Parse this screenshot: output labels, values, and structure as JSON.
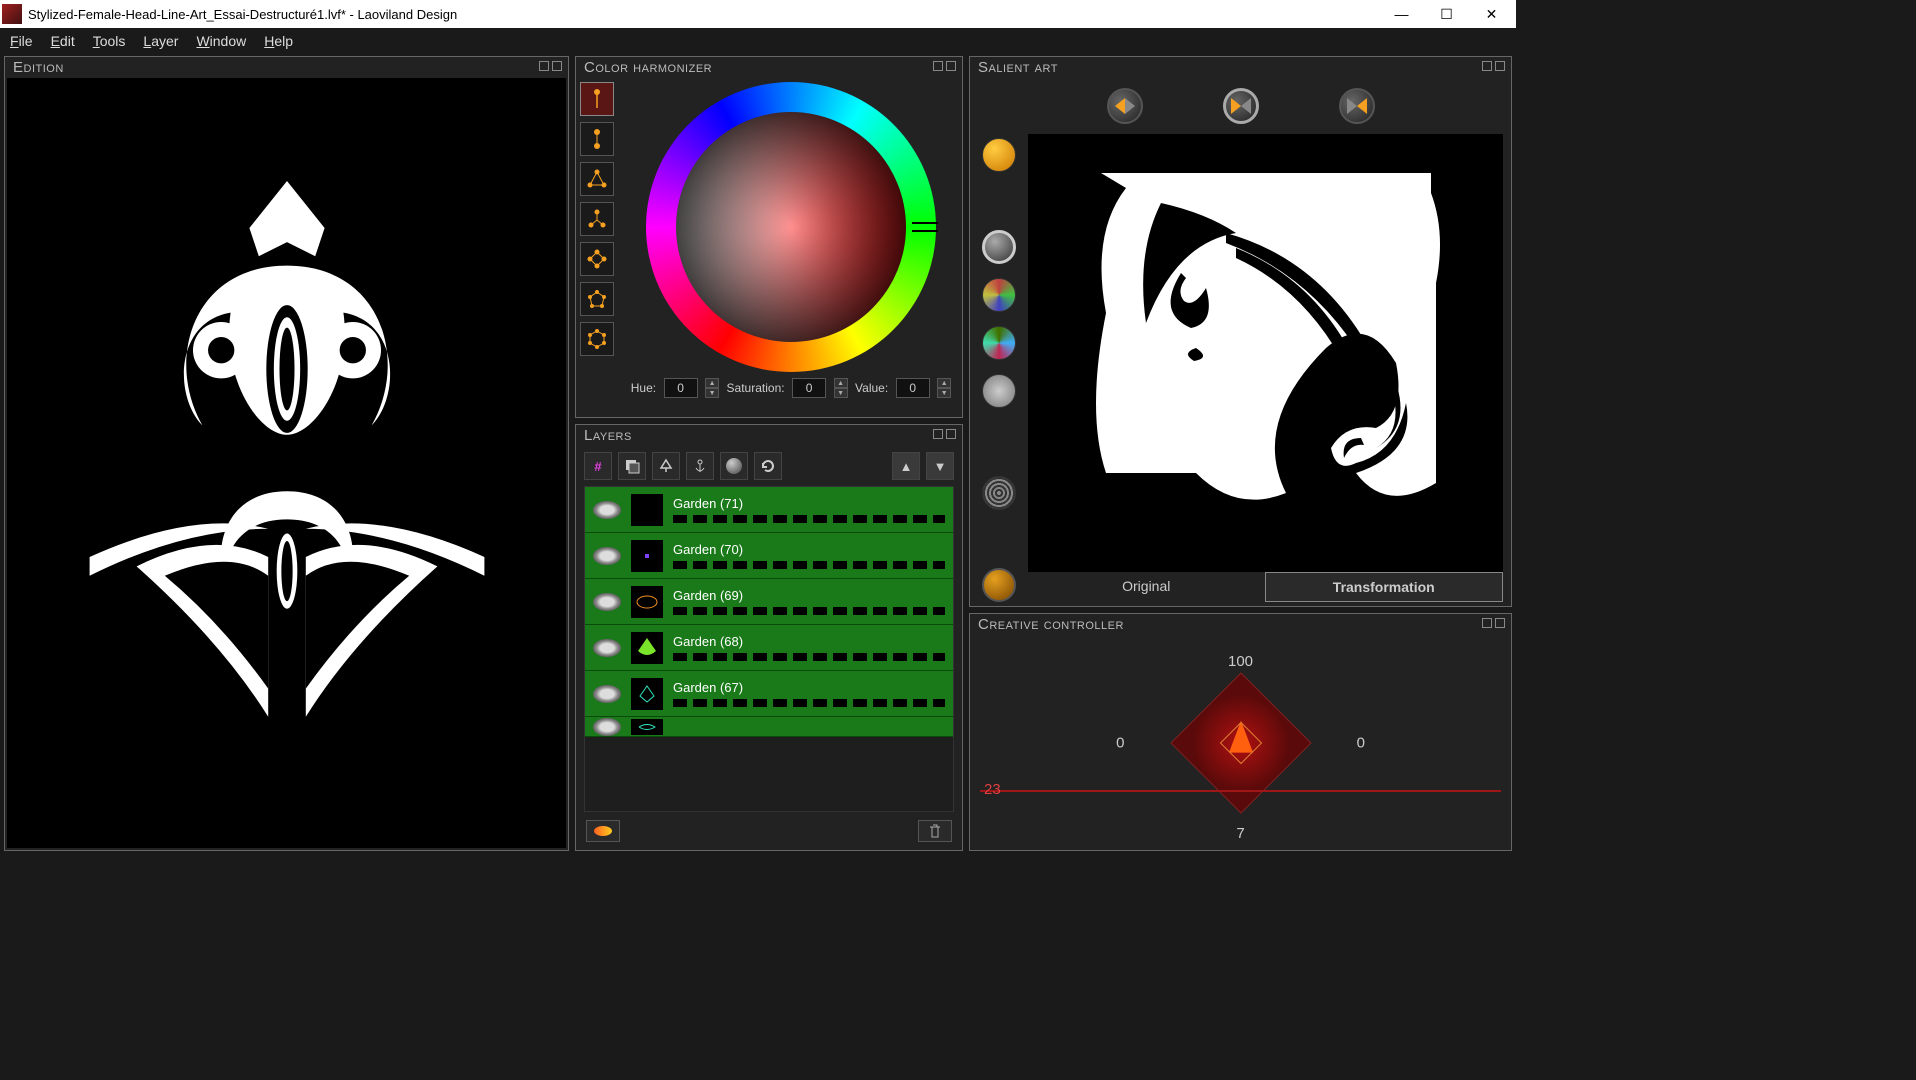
{
  "window": {
    "title": "Stylized-Female-Head-Line-Art_Essai-Destructuré1.lvf* - Laoviland Design"
  },
  "menu": {
    "file": "File",
    "edit": "Edit",
    "tools": "Tools",
    "layer": "Layer",
    "window": "Window",
    "help": "Help"
  },
  "panels": {
    "edition": "Edition",
    "color_harmonizer": "Color harmonizer",
    "layers": "Layers",
    "salient_art": "Salient art",
    "creative_controller": "Creative controller"
  },
  "harmonizer": {
    "hue_label": "Hue:",
    "hue_value": "0",
    "sat_label": "Saturation:",
    "sat_value": "0",
    "val_label": "Value:",
    "val_value": "0"
  },
  "layers_list": [
    {
      "name": "Garden (71)"
    },
    {
      "name": "Garden (70)"
    },
    {
      "name": "Garden (69)"
    },
    {
      "name": "Garden (68)"
    },
    {
      "name": "Garden (67)"
    }
  ],
  "salient": {
    "tab_original": "Original",
    "tab_transformation": "Transformation"
  },
  "creative": {
    "top": "100",
    "left": "0",
    "right": "0",
    "bottom": "7",
    "red": "23"
  }
}
